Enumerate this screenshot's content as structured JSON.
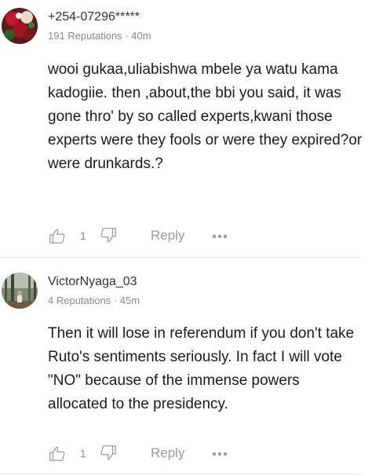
{
  "comments": [
    {
      "author": "+254-07296*****",
      "meta": "191 Reputations · 40m",
      "text": "wooi gukaa,uliabishwa mbele ya watu kama kadogiie. then ,about,the bbi you said, it was gone thro' by so called experts,kwani those experts were they fools or were they expired?or were drunkards.?",
      "likes": "1",
      "reply_label": "Reply"
    },
    {
      "author": "VictorNyaga_03",
      "meta": "4 Reputations · 45m",
      "text": "Then it will lose in referendum if you don't take Ruto's sentiments seriously. In fact I will vote \"NO\" because of the immense powers allocated to the presidency.",
      "likes": "1",
      "reply_label": "Reply"
    }
  ],
  "icons": {
    "like": "thumbs-up-outline-icon",
    "dislike": "thumbs-down-outline-icon",
    "more": "three-dots-icon"
  },
  "colors": {
    "text": "#1a1a1a",
    "muted": "#8a8a8a",
    "divider": "#e6e6e6"
  }
}
